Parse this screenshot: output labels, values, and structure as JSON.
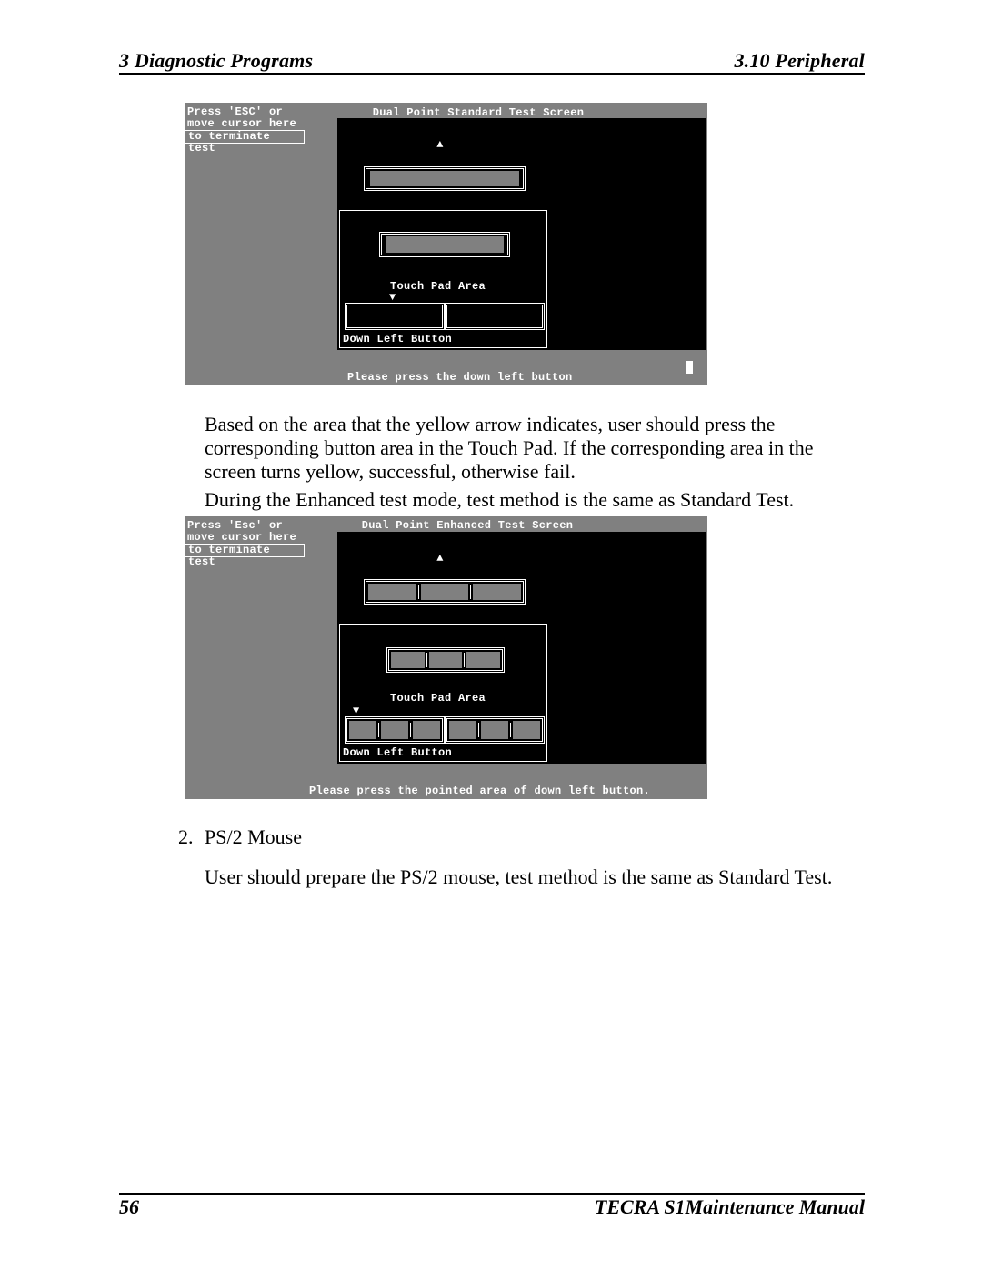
{
  "header": {
    "left": "3  Diagnostic Programs",
    "right": "3.10 Peripheral"
  },
  "fig1": {
    "terminate_l1": "Press 'ESC' or",
    "terminate_l2": "move cursor here",
    "terminate_l3": "to terminate test",
    "title": "Dual Point Standard Test Screen",
    "arrow_up": "▲",
    "pad_label": "Touch Pad Area",
    "arrow_down": "▼",
    "down_left": "Down Left Button",
    "prompt": "Please press the down left button"
  },
  "para1": "Based on the area that the yellow arrow indicates, user should press the corresponding button area in the Touch Pad. If the corresponding area in the screen turns yellow, successful, otherwise fail.",
  "para2": "During the Enhanced test mode, test method is the same as Standard Test.",
  "fig2": {
    "terminate_l1": "Press 'Esc' or",
    "terminate_l2": "move cursor here",
    "terminate_l3": "to terminate test",
    "title": "Dual Point Enhanced Test Screen",
    "arrow_up": "▲",
    "pad_label": "Touch Pad Area",
    "arrow_down": "▼",
    "down_left": "Down Left Button",
    "prompt": "Please press the pointed area of down left button."
  },
  "list": {
    "num": "2.",
    "label": "PS/2 Mouse"
  },
  "para3": "User should prepare the PS/2 mouse, test method is the same as Standard Test.",
  "footer": {
    "left": "56",
    "right": "TECRA S1Maintenance Manual"
  }
}
